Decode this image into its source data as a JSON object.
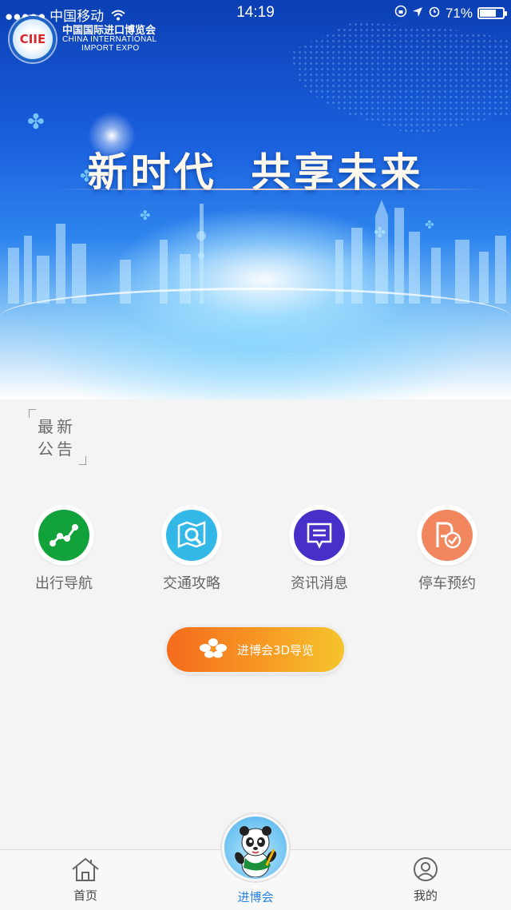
{
  "status_bar": {
    "carrier": "●●●●● 中国移动",
    "time": "14:19",
    "battery_pct": "71%",
    "battery_level": 0.71
  },
  "logo": {
    "badge_text": "CIIE",
    "name_cn": "中国国际进口博览会",
    "name_en_1": "CHINA INTERNATIONAL",
    "name_en_2": "IMPORT EXPO"
  },
  "hero": {
    "slogan": "新时代  共享未来"
  },
  "notice": {
    "label": "最新公告"
  },
  "actions": [
    {
      "label": "出行导航",
      "icon": "route-icon",
      "color": "#12a23c"
    },
    {
      "label": "交通攻略",
      "icon": "map-search-icon",
      "color": "#33b8e8"
    },
    {
      "label": "资讯消息",
      "icon": "message-icon",
      "color": "#4630c8"
    },
    {
      "label": "停车预约",
      "icon": "parking-check-icon",
      "color": "#f2865e"
    }
  ],
  "guide_button": {
    "label": "进博会3D导览",
    "icon": "flower-logo-icon"
  },
  "tabbar": {
    "home": "首页",
    "expo": "进博会",
    "mine": "我的",
    "active": "进博会",
    "active_color": "#2a84e3"
  }
}
